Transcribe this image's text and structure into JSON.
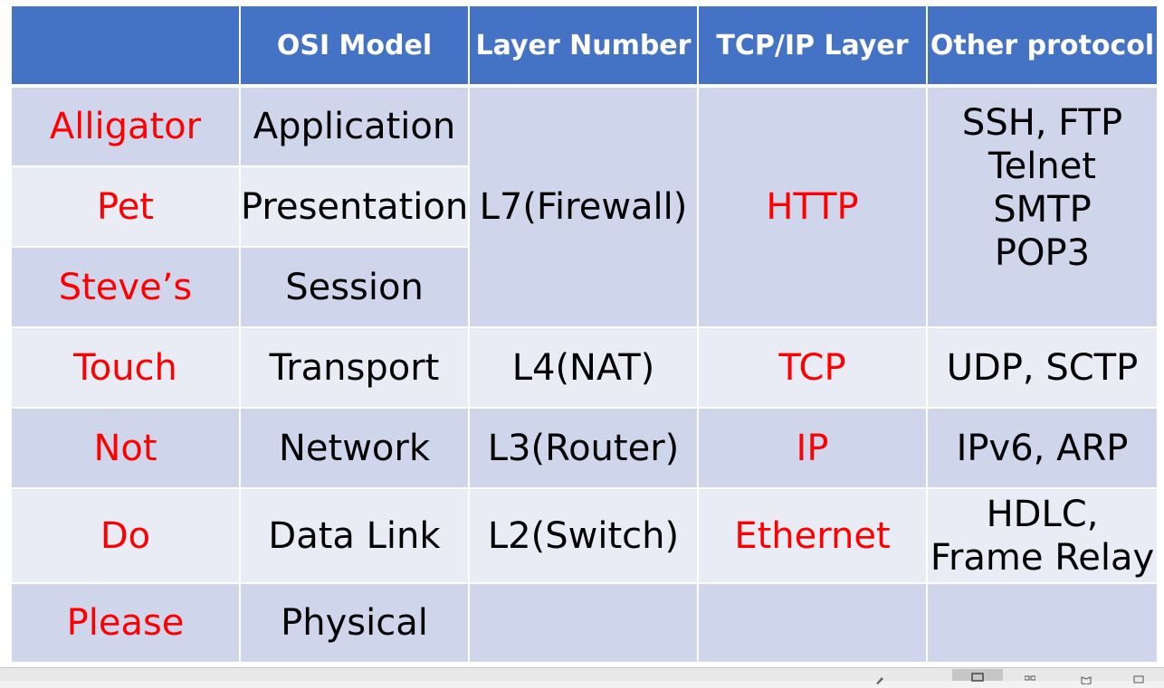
{
  "header": [
    "",
    "OSI Model",
    "Layer Number",
    "TCP/IP Layer",
    "Other protocol"
  ],
  "rows": [
    {
      "mnemonic": "Alligator",
      "osi": "Application"
    },
    {
      "mnemonic": "Pet",
      "osi": "Presentation"
    },
    {
      "mnemonic": "Steve’s",
      "osi": "Session"
    },
    {
      "mnemonic": "Touch",
      "osi": "Transport",
      "layer": "L4(NAT)",
      "tcpip": "TCP",
      "other": "UDP, SCTP"
    },
    {
      "mnemonic": "Not",
      "osi": "Network",
      "layer": "L3(Router)",
      "tcpip": "IP",
      "other": "IPv6, ARP"
    },
    {
      "mnemonic": "Do",
      "osi": "Data Link",
      "layer": "L2(Switch)",
      "tcpip": "Ethernet",
      "other_lines": [
        "HDLC,",
        "Frame Relay"
      ]
    },
    {
      "mnemonic": "Please",
      "osi": "Physical",
      "layer": "",
      "tcpip": "",
      "other": ""
    }
  ],
  "merged": {
    "layer": "L7(Firewall)",
    "tcpip": "HTTP",
    "other_lines": [
      "SSH, FTP",
      "Telnet",
      "SMTP",
      "POP3"
    ]
  },
  "colors": {
    "header_bg": "#4472c4",
    "row_dark": "#cfd5ea",
    "row_light": "#e9ebf5",
    "accent_red": "#ff0000"
  }
}
